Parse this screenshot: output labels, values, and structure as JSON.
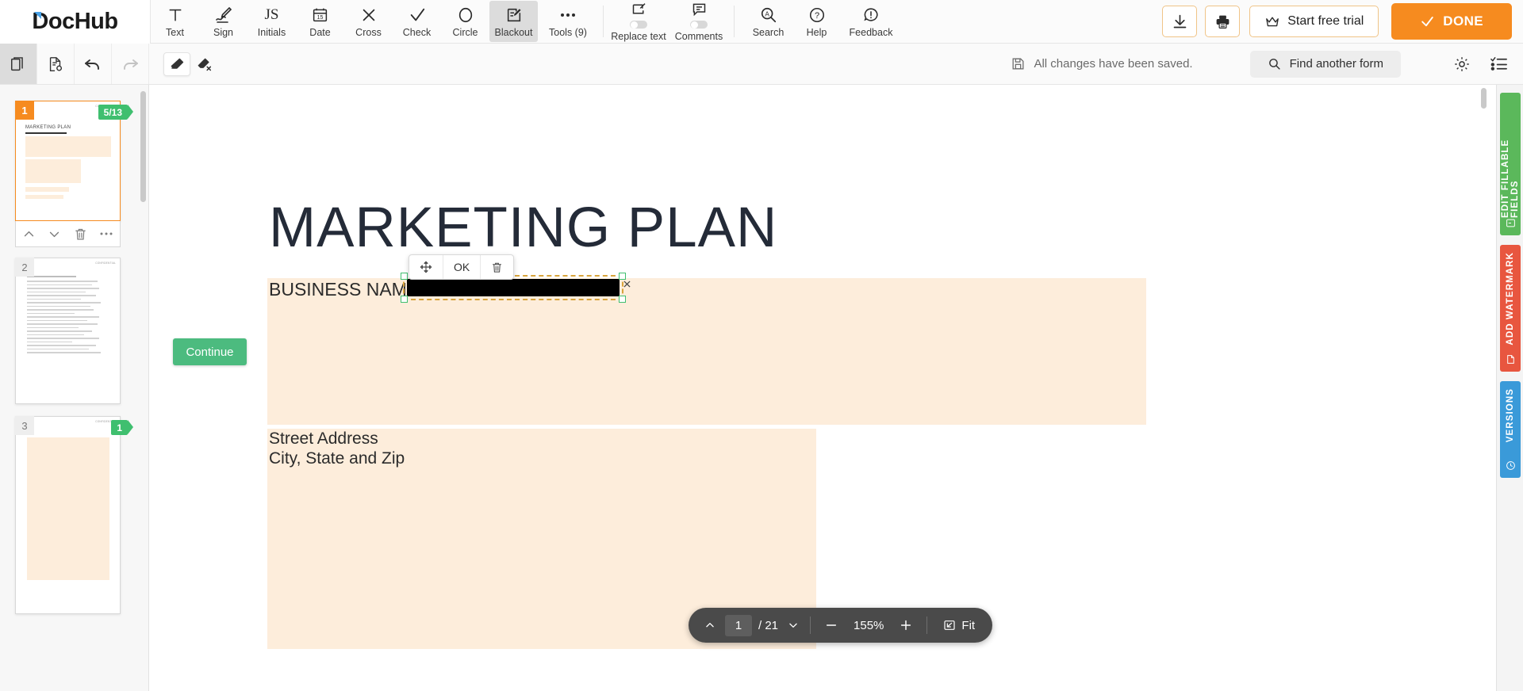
{
  "app": {
    "logo_text": "DocHub"
  },
  "toolbar": {
    "tools": [
      {
        "label": "Text",
        "icon": "text-icon"
      },
      {
        "label": "Sign",
        "icon": "sign-pen-icon"
      },
      {
        "label": "Initials",
        "icon": "initials-js-icon"
      },
      {
        "label": "Date",
        "icon": "calendar-icon"
      },
      {
        "label": "Cross",
        "icon": "cross-icon"
      },
      {
        "label": "Check",
        "icon": "check-icon"
      },
      {
        "label": "Circle",
        "icon": "circle-icon"
      },
      {
        "label": "Blackout",
        "icon": "blackout-icon",
        "active": true
      },
      {
        "label": "Tools (9)",
        "icon": "ellipsis-icon"
      }
    ],
    "toggles": [
      {
        "label": "Replace text",
        "icon": "replace-text-icon",
        "on": false
      },
      {
        "label": "Comments",
        "icon": "comment-icon",
        "on": false
      }
    ],
    "utilities": [
      {
        "label": "Search",
        "icon": "search-a-icon"
      },
      {
        "label": "Help",
        "icon": "question-circle-icon"
      },
      {
        "label": "Feedback",
        "icon": "exclamation-bubble-icon"
      }
    ],
    "download_icon": "download-icon",
    "print_icon": "printer-icon",
    "trial_label": "Start free trial",
    "trial_icon": "crown-icon",
    "done_label": "DONE",
    "done_icon": "check-icon",
    "accent_orange": "#f68b1f"
  },
  "subbar": {
    "left_buttons": [
      {
        "name": "pages-panel",
        "icon": "pages-icon",
        "active": true
      },
      {
        "name": "document-settings",
        "icon": "document-gear-icon",
        "active": false
      },
      {
        "name": "undo",
        "icon": "undo-icon",
        "active": false
      },
      {
        "name": "redo",
        "icon": "redo-icon",
        "active": false
      }
    ],
    "eraser_buttons": [
      {
        "name": "eraser",
        "icon": "eraser-icon",
        "selected": true
      },
      {
        "name": "eraser-clear-all",
        "icon": "eraser-x-icon",
        "selected": false
      }
    ],
    "save_status": "All changes have been saved.",
    "save_icon": "floppy-disk-icon",
    "find_label": "Find another form",
    "find_icon": "search-icon",
    "settings_icon": "gear-icon",
    "list_icon": "checklist-icon"
  },
  "thumbnails": {
    "pages": [
      {
        "number": "1",
        "badge": "5/13",
        "active": true,
        "title": "MARKETING PLAN",
        "confidential": "CONFIDENTIAL"
      },
      {
        "number": "2",
        "badge": "",
        "active": false,
        "title": "",
        "confidential": "CONFIDENTIAL"
      },
      {
        "number": "3",
        "badge": "1",
        "active": false,
        "title": "",
        "confidential": "CONFIDENTIAL"
      }
    ],
    "actions": [
      {
        "name": "move-page-up",
        "icon": "chevron-up-icon"
      },
      {
        "name": "move-page-down",
        "icon": "chevron-down-icon"
      },
      {
        "name": "delete-page",
        "icon": "trash-icon"
      },
      {
        "name": "page-more-options",
        "icon": "ellipsis-icon"
      }
    ],
    "badge_color": "#3fbf6f"
  },
  "document": {
    "title": "MARKETING PLAN",
    "business_name_label": "BUSINESS NAME",
    "address_line1": "Street Address",
    "address_line2": "City, State and Zip",
    "blackout_redaction": "",
    "highlight_color": "#fdeddb"
  },
  "edit_popup": {
    "move_icon": "move-arrows-icon",
    "ok_label": "OK",
    "delete_icon": "trash-icon"
  },
  "continue": {
    "label": "Continue",
    "color": "#4cbb7f"
  },
  "zoom_controls": {
    "collapse_icon": "chevron-up-icon",
    "current_page": "1",
    "page_separator": "/ 21",
    "total_pages": "21",
    "page_dropdown_icon": "chevron-down-icon",
    "zoom_out_icon": "minus-icon",
    "zoom_level": "155%",
    "zoom_in_icon": "plus-icon",
    "fit_label": "Fit",
    "fit_icon": "fit-screen-icon"
  },
  "right_rail": {
    "tabs": [
      {
        "label": "EDIT FILLABLE FIELDS",
        "color": "#5bb85b",
        "icon": "fillable-field-icon"
      },
      {
        "label": "ADD WATERMARK",
        "color": "#e8563f",
        "icon": "watermark-icon"
      },
      {
        "label": "VERSIONS",
        "color": "#3a9ad9",
        "icon": "clock-history-icon"
      }
    ]
  }
}
